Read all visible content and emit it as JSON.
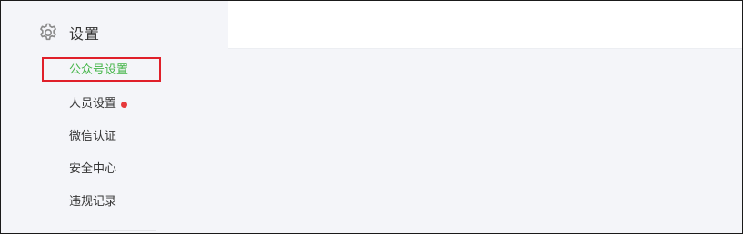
{
  "sidebar": {
    "section_title": "设置",
    "section_icon": "gear-icon",
    "items": [
      {
        "label": "公众号设置",
        "active": true
      },
      {
        "label": "人员设置",
        "badge": "red-dot"
      },
      {
        "label": "微信认证"
      },
      {
        "label": "安全中心"
      },
      {
        "label": "违规记录"
      }
    ]
  },
  "colors": {
    "active_text": "#44b549",
    "highlight_border": "#e0202a",
    "badge_dot": "#e6393b",
    "sidebar_bg": "#f4f5f9"
  }
}
